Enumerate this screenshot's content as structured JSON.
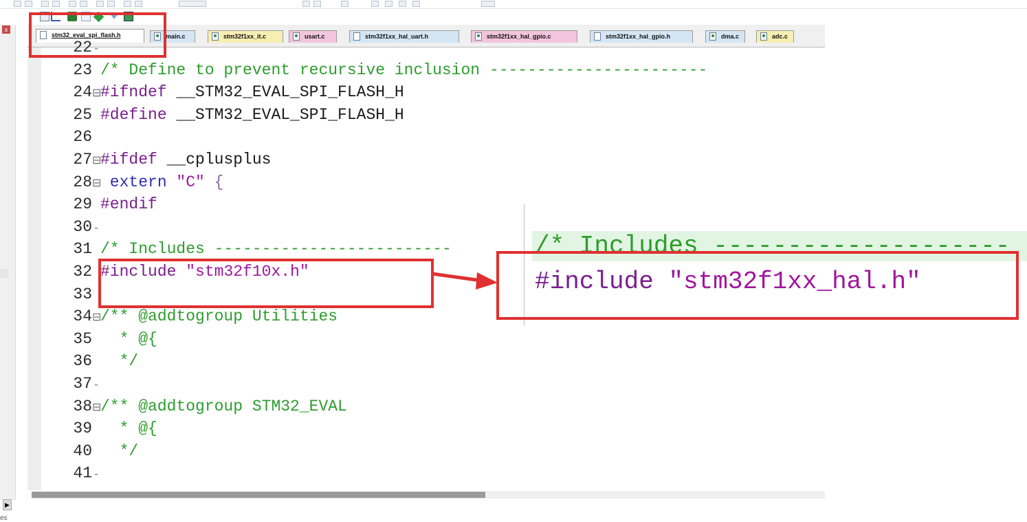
{
  "tabs": [
    {
      "label": "stm32_eval_spi_flash.h",
      "active": true,
      "bg": "#ffffff",
      "kind": "h"
    },
    {
      "label": "main.c",
      "active": false,
      "bg": "#d4e6f4",
      "kind": "c"
    },
    {
      "label": "stm32f1xx_it.c",
      "active": false,
      "bg": "#f7eeb2",
      "kind": "c"
    },
    {
      "label": "usart.c",
      "active": false,
      "bg": "#f2c4dd",
      "kind": "c"
    },
    {
      "label": "stm32f1xx_hal_uart.h",
      "active": false,
      "bg": "#d4e6f4",
      "kind": "h"
    },
    {
      "label": "stm32f1xx_hal_gpio.c",
      "active": false,
      "bg": "#f2c4dd",
      "kind": "c"
    },
    {
      "label": "stm32f1xx_hal_gpio.h",
      "active": false,
      "bg": "#d4e6f4",
      "kind": "h"
    },
    {
      "label": "dma.c",
      "active": false,
      "bg": "#d4e6f4",
      "kind": "c"
    },
    {
      "label": "adc.c",
      "active": false,
      "bg": "#f7eeb2",
      "kind": "c"
    }
  ],
  "editor": {
    "lines": [
      {
        "num": "22",
        "fold": "-",
        "parts": [
          {
            "cls": "tx",
            "text": ""
          }
        ]
      },
      {
        "num": "23",
        "fold": "",
        "parts": [
          {
            "cls": "cm",
            "text": "/* Define to prevent recursive inclusion -----------------------"
          }
        ]
      },
      {
        "num": "24",
        "fold": "⊟",
        "parts": [
          {
            "cls": "pp",
            "text": "#ifndef "
          },
          {
            "cls": "tx",
            "text": "__STM32_EVAL_SPI_FLASH_H"
          }
        ]
      },
      {
        "num": "25",
        "fold": "",
        "parts": [
          {
            "cls": "pp",
            "text": "#define "
          },
          {
            "cls": "tx",
            "text": "__STM32_EVAL_SPI_FLASH_H"
          }
        ]
      },
      {
        "num": "26",
        "fold": "",
        "parts": [
          {
            "cls": "tx",
            "text": ""
          }
        ]
      },
      {
        "num": "27",
        "fold": "⊟",
        "parts": [
          {
            "cls": "pp",
            "text": "#ifdef "
          },
          {
            "cls": "tx",
            "text": "__cplusplus"
          }
        ]
      },
      {
        "num": "28",
        "fold": "⊟",
        "parts": [
          {
            "cls": "kw",
            "text": " extern "
          },
          {
            "cls": "st",
            "text": "\"C\""
          },
          {
            "cls": "dim",
            "text": " {"
          }
        ]
      },
      {
        "num": "29",
        "fold": "",
        "parts": [
          {
            "cls": "pp",
            "text": "#endif"
          }
        ]
      },
      {
        "num": "30",
        "fold": "-",
        "parts": [
          {
            "cls": "tx",
            "text": ""
          }
        ]
      },
      {
        "num": "31",
        "fold": "",
        "parts": [
          {
            "cls": "cm",
            "text": "/* Includes -------------------------"
          }
        ]
      },
      {
        "num": "32",
        "fold": "",
        "parts": [
          {
            "cls": "pp",
            "text": "#include "
          },
          {
            "cls": "st",
            "text": "\"stm32f10x.h\""
          }
        ]
      },
      {
        "num": "33",
        "fold": "",
        "parts": [
          {
            "cls": "tx",
            "text": ""
          }
        ]
      },
      {
        "num": "34",
        "fold": "⊟",
        "parts": [
          {
            "cls": "cm",
            "text": "/** @addtogroup Utilities"
          }
        ]
      },
      {
        "num": "35",
        "fold": "",
        "parts": [
          {
            "cls": "cm",
            "text": "  * @{"
          }
        ]
      },
      {
        "num": "36",
        "fold": "",
        "parts": [
          {
            "cls": "cm",
            "text": "  */"
          }
        ]
      },
      {
        "num": "37",
        "fold": "-",
        "parts": [
          {
            "cls": "tx",
            "text": ""
          }
        ]
      },
      {
        "num": "38",
        "fold": "⊟",
        "parts": [
          {
            "cls": "cm",
            "text": "/** @addtogroup STM32_EVAL"
          }
        ]
      },
      {
        "num": "39",
        "fold": "",
        "parts": [
          {
            "cls": "cm",
            "text": "  * @{"
          }
        ]
      },
      {
        "num": "40",
        "fold": "",
        "parts": [
          {
            "cls": "cm",
            "text": "  */"
          }
        ]
      },
      {
        "num": "41",
        "fold": "-",
        "parts": [
          {
            "cls": "tx",
            "text": ""
          }
        ]
      }
    ]
  },
  "inset": {
    "comment": "/* Includes --------------------",
    "include_kw": "#include ",
    "include_str": "\"stm32f1xx_hal.h\""
  },
  "left_panel": {
    "close_glyph": "x",
    "scroll_glyph": "▶",
    "label": "es"
  },
  "colors": {
    "annotation_red": "#e03030"
  }
}
